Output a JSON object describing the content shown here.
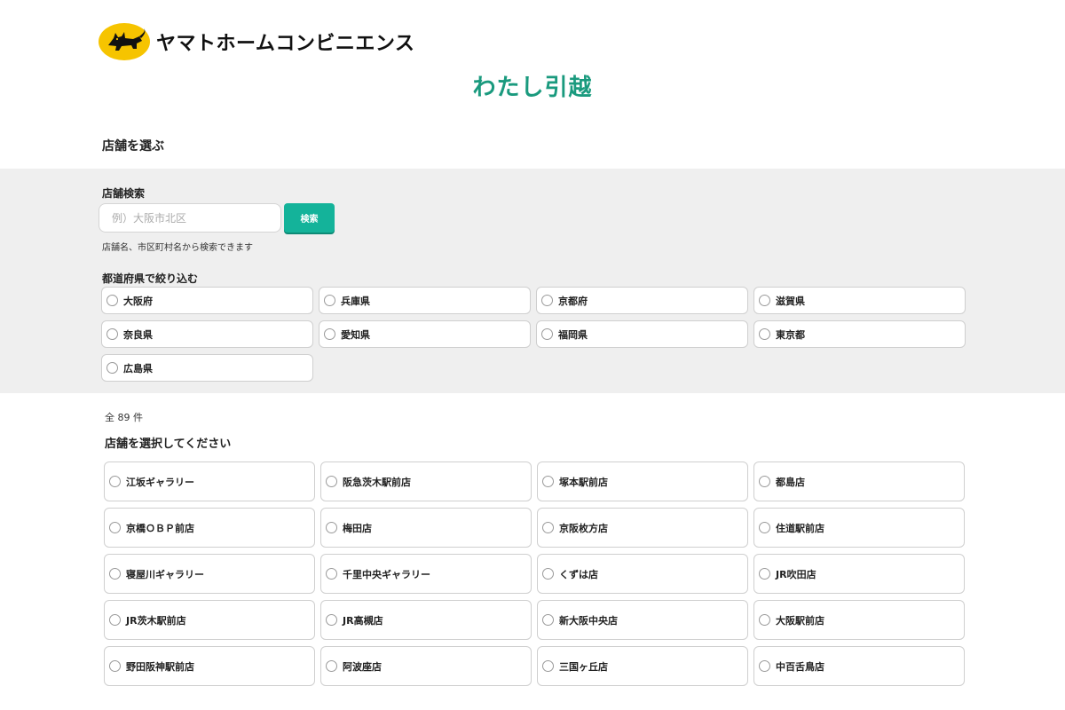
{
  "brand": {
    "name": "ヤマトホームコンビニエンス",
    "logo_color": "#f6c400",
    "service_name": "わたし引越",
    "service_color": "#1a9a7e"
  },
  "page_title": "店舗を選ぶ",
  "search": {
    "label": "店舗検索",
    "placeholder": "例）大阪市北区",
    "value": "",
    "button_label": "検索",
    "button_color": "#14b39a",
    "hint": "店舗名、市区町村名から検索できます"
  },
  "prefecture_filter": {
    "label": "都道府県で絞り込む",
    "options": [
      "大阪府",
      "兵庫県",
      "京都府",
      "滋賀県",
      "奈良県",
      "愛知県",
      "福岡県",
      "東京都",
      "広島県"
    ]
  },
  "results": {
    "count_label": "全 89 件",
    "select_label": "店舗を選択してください",
    "stores": [
      "江坂ギャラリー",
      "阪急茨木駅前店",
      "塚本駅前店",
      "都島店",
      "京橋ＯＢＰ前店",
      "梅田店",
      "京阪枚方店",
      "住道駅前店",
      "寝屋川ギャラリー",
      "千里中央ギャラリー",
      "くずは店",
      "JR吹田店",
      "JR茨木駅前店",
      "JR高槻店",
      "新大阪中央店",
      "大阪駅前店",
      "野田阪神駅前店",
      "阿波座店",
      "三国ヶ丘店",
      "中百舌鳥店"
    ]
  }
}
